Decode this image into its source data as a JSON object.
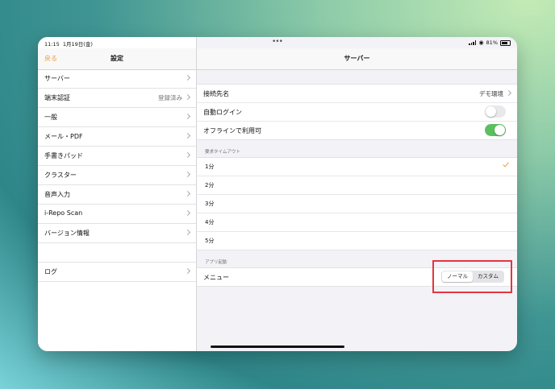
{
  "status": {
    "time": "11:15",
    "date": "1月19日(金)",
    "dots": "•••",
    "battery": "81%"
  },
  "sidebar": {
    "back_label": "戻る",
    "title": "設定",
    "items": [
      {
        "label": "サーバー",
        "value": ""
      },
      {
        "label": "端末認証",
        "value": "登録済み"
      },
      {
        "label": "一般",
        "value": ""
      },
      {
        "label": "メール・PDF",
        "value": ""
      },
      {
        "label": "手書きパッド",
        "value": ""
      },
      {
        "label": "クラスター",
        "value": ""
      },
      {
        "label": "音声入力",
        "value": ""
      },
      {
        "label": "i-Repo Scan",
        "value": ""
      },
      {
        "label": "バージョン情報",
        "value": ""
      }
    ],
    "log_label": "ログ"
  },
  "main": {
    "title": "サーバー",
    "connection": {
      "label": "接続先名",
      "value": "デモ環境"
    },
    "auto_login": {
      "label": "自動ログイン",
      "on": false
    },
    "offline": {
      "label": "オフラインで利用可",
      "on": true
    },
    "timeout_header": "要求タイムアウト",
    "timeouts": [
      "1分",
      "2分",
      "3分",
      "4分",
      "5分"
    ],
    "selected_timeout": "1分",
    "launch_header": "アプリ起動",
    "menu_label": "メニュー",
    "segments": [
      "ノーマル",
      "カスタム"
    ],
    "selected_segment": "ノーマル"
  },
  "colors": {
    "accent": "#f19a3a",
    "toggle_on": "#5cbf5f",
    "highlight": "#e6353f"
  }
}
